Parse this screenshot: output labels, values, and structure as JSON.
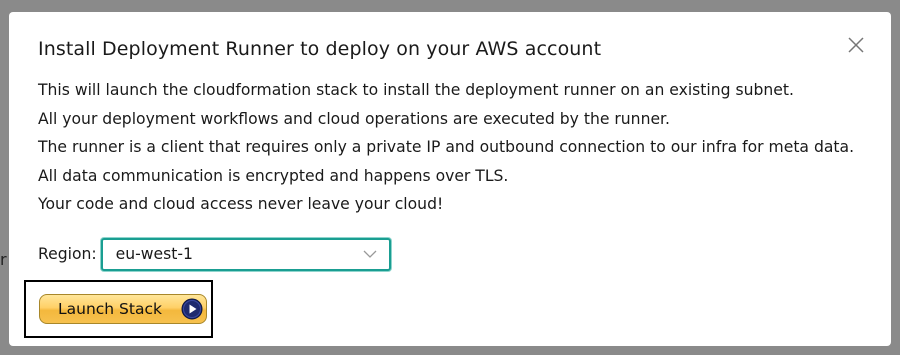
{
  "backdrop": {
    "partial_text": "r"
  },
  "modal": {
    "title": "Install Deployment Runner to deploy on your AWS account",
    "close_icon": "close-icon",
    "description": [
      "This will launch the cloudformation stack to install the deployment runner on an existing subnet.",
      "All your deployment workflows and cloud operations are executed by the runner.",
      "The runner is a client that requires only a private IP and outbound connection to our infra for meta data. All data communication is encrypted and happens over TLS.",
      "Your code and cloud access never leave your cloud!"
    ],
    "region": {
      "label": "Region:",
      "selected": "eu-west-1",
      "chevron_icon": "chevron-down-icon"
    },
    "launch_button": {
      "label": "Launch Stack",
      "arrow_icon": "play-arrow-icon"
    }
  },
  "colors": {
    "select_border": "#1a9e92",
    "button_gold": "#f4b83d",
    "arrow_circle": "#1e2a6e"
  }
}
